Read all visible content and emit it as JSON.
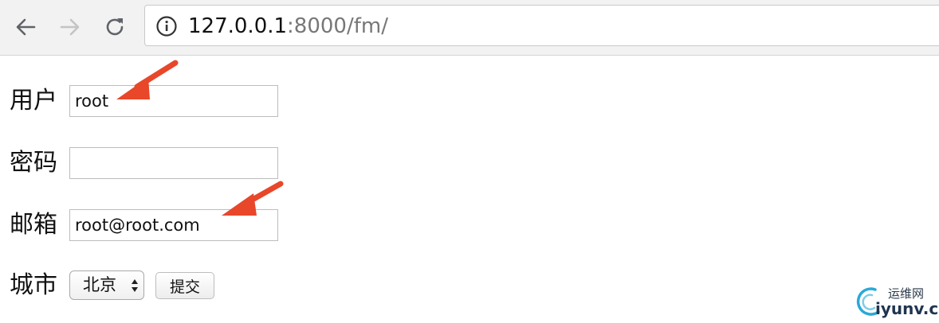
{
  "browser": {
    "url_host": "127.0.0.1",
    "url_rest": ":8000/fm/",
    "icons": {
      "back": "back-arrow-icon",
      "forward": "forward-arrow-icon",
      "reload": "reload-icon",
      "info": "info-icon"
    }
  },
  "form": {
    "user_label": "用户",
    "user_value": "root",
    "password_label": "密码",
    "password_value": "",
    "email_label": "邮箱",
    "email_value": "root@root.com",
    "city_label": "城市",
    "city_selected": "北京",
    "submit_label": "提交"
  },
  "annotations": {
    "arrow_color": "#e8472a"
  },
  "watermark": {
    "line1": "运维网",
    "line2": "iyunv.com"
  }
}
